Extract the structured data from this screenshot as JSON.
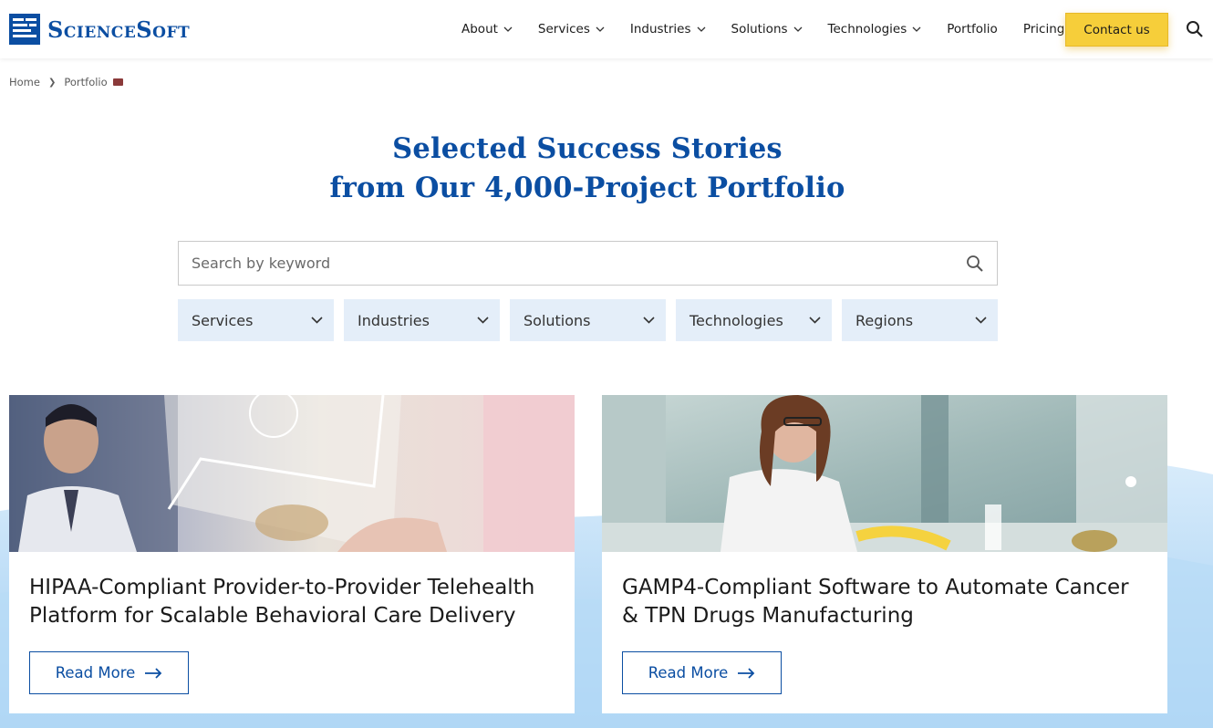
{
  "brand": {
    "name": "ScienceSoft"
  },
  "nav": {
    "items": [
      {
        "label": "About",
        "dropdown": true
      },
      {
        "label": "Services",
        "dropdown": true
      },
      {
        "label": "Industries",
        "dropdown": true
      },
      {
        "label": "Solutions",
        "dropdown": true
      },
      {
        "label": "Technologies",
        "dropdown": true
      },
      {
        "label": "Portfolio",
        "dropdown": false
      },
      {
        "label": "Pricing",
        "dropdown": false
      }
    ],
    "contact_label": "Contact us",
    "search_icon": "search-icon"
  },
  "breadcrumb": {
    "home": "Home",
    "current": "Portfolio"
  },
  "hero": {
    "title_line1": "Selected Success Stories",
    "title_line2": "from Our 4,000-Project Portfolio"
  },
  "search": {
    "placeholder": "Search by keyword"
  },
  "filters": [
    "Services",
    "Industries",
    "Solutions",
    "Technologies",
    "Regions"
  ],
  "cards": [
    {
      "title": "HIPAA-Compliant Provider-to-Provider Telehealth Platform for Scalable Behavioral Care Delivery",
      "button": "Read More"
    },
    {
      "title": "GAMP4-Compliant Software to Automate Cancer & TPN Drugs Manufacturing",
      "button": "Read More"
    }
  ],
  "colors": {
    "brand_blue": "#0b4ea2",
    "contact_yellow": "#f6ce3a",
    "filter_bg": "#e4eef9",
    "wave_blue": "#a9d1f3"
  }
}
